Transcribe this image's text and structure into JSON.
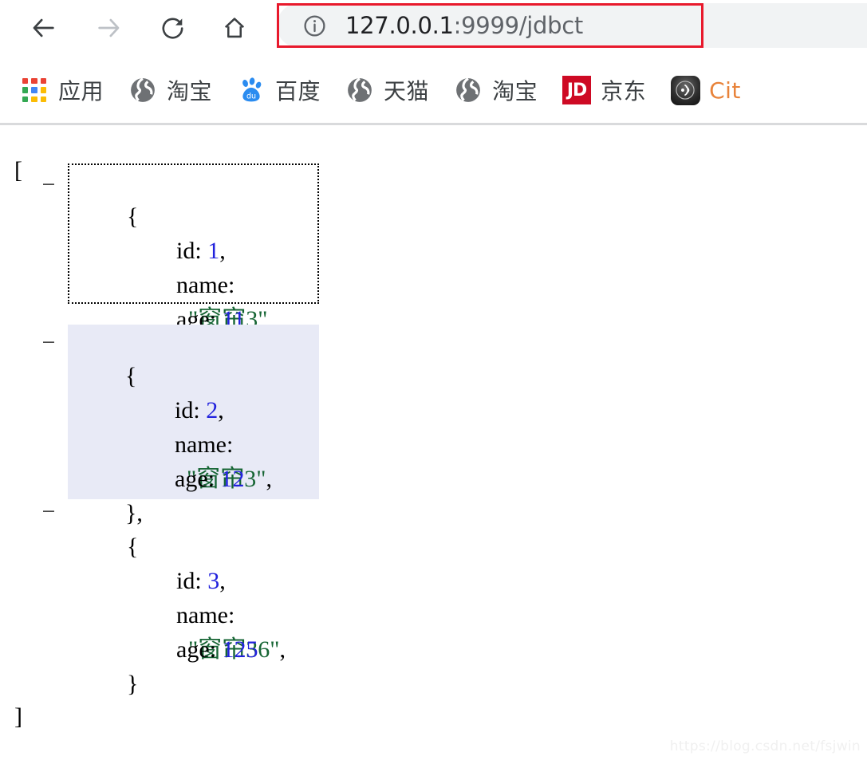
{
  "browser": {
    "nav": {
      "back_label": "Back",
      "forward_label": "Forward",
      "reload_label": "Reload",
      "home_label": "Home"
    },
    "address_bar": {
      "info_icon": "info-circle-icon",
      "url_host": "127.0.0.1",
      "url_path": ":9999/jdbct",
      "full_url": "127.0.0.1:9999/jdbct",
      "highlight_color": "#e8192c",
      "background_color": "#f1f3f4"
    },
    "bookmarks": [
      {
        "label": "应用",
        "icon": "apps-grid-icon"
      },
      {
        "label": "淘宝",
        "icon": "globe-icon"
      },
      {
        "label": "百度",
        "icon": "baidu-paw-icon"
      },
      {
        "label": "天猫",
        "icon": "globe-icon"
      },
      {
        "label": "淘宝",
        "icon": "globe-icon"
      },
      {
        "label": "京东",
        "icon": "jd-icon",
        "icon_text": "JD"
      },
      {
        "label": "Cit",
        "icon": "citi-icon"
      }
    ]
  },
  "json_viewer": {
    "open_bracket": "[",
    "close_bracket": "]",
    "toggle_glyph": "−",
    "open_brace": "{",
    "close_brace": "}",
    "comma": ",",
    "colon": ":",
    "quote": "\"",
    "keys": {
      "id": "id",
      "name": "name",
      "age": "age"
    },
    "colors": {
      "key": "#000000",
      "number": "#2222dd",
      "string": "#166534",
      "highlight_bg": "#e8eaf6"
    },
    "records": [
      {
        "id": "1",
        "name": "窗帘3",
        "age": "11",
        "state": "hover",
        "trailing_comma": ","
      },
      {
        "id": "2",
        "name": "窗帘3",
        "age": "12",
        "state": "selected",
        "trailing_comma": ","
      },
      {
        "id": "3",
        "name": "窗帘36",
        "age": "125",
        "state": "normal",
        "trailing_comma": ""
      }
    ]
  },
  "watermark": {
    "text": "https://blog.csdn.net/fsjwin"
  }
}
